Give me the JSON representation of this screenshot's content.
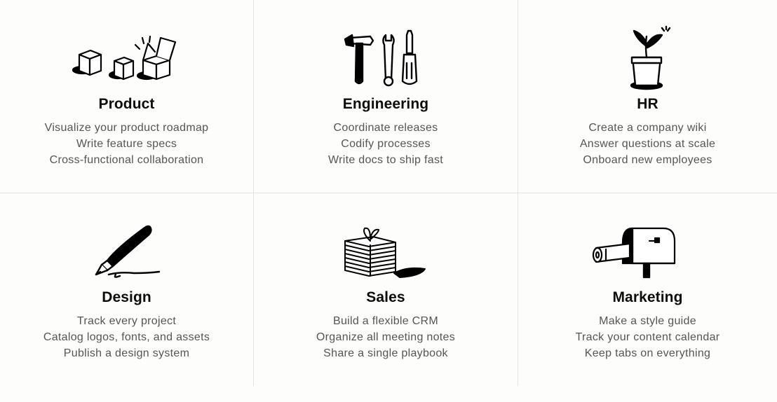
{
  "categories": [
    {
      "icon": "boxes-icon",
      "title": "Product",
      "features": [
        "Visualize your product roadmap",
        "Write feature specs",
        "Cross-functional collaboration"
      ]
    },
    {
      "icon": "tools-icon",
      "title": "Engineering",
      "features": [
        "Coordinate releases",
        "Codify processes",
        "Write docs to ship fast"
      ]
    },
    {
      "icon": "plant-icon",
      "title": "HR",
      "features": [
        "Create a company wiki",
        "Answer questions at scale",
        "Onboard new employees"
      ]
    },
    {
      "icon": "pen-icon",
      "title": "Design",
      "features": [
        "Track every project",
        "Catalog logos, fonts, and assets",
        "Publish a design system"
      ]
    },
    {
      "icon": "paper-stack-icon",
      "title": "Sales",
      "features": [
        "Build a flexible CRM",
        "Organize all meeting notes",
        "Share a single playbook"
      ]
    },
    {
      "icon": "mailbox-icon",
      "title": "Marketing",
      "features": [
        "Make a style guide",
        "Track your content calendar",
        "Keep tabs on everything"
      ]
    }
  ]
}
